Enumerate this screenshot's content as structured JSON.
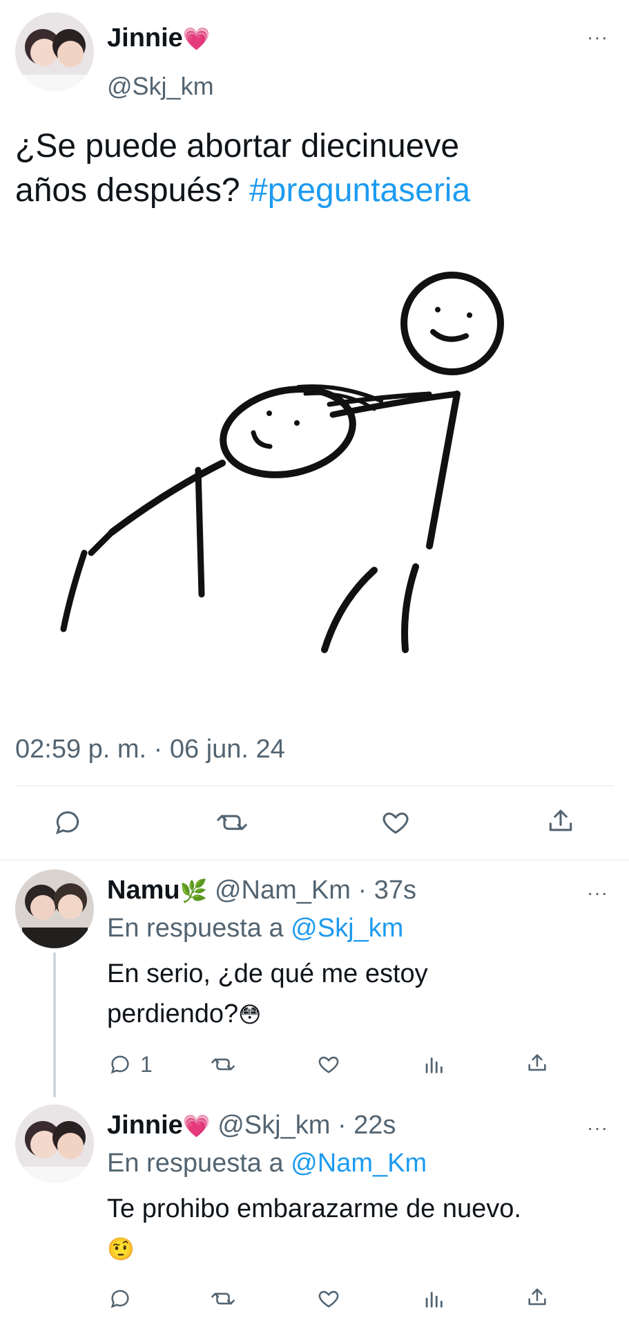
{
  "main_tweet": {
    "author_name": "Jinnie",
    "author_emoji": "💗",
    "author_handle": "@Skj_km",
    "text_part1": "¿Se puede abortar diecinueve",
    "text_part2": "años después? ",
    "hashtag": "#preguntaseria",
    "timestamp": "02:59 p. m. · 06 jun. 24",
    "more": "···",
    "action_icons": [
      "reply-icon",
      "retweet-icon",
      "like-icon",
      "share-icon"
    ]
  },
  "replies": [
    {
      "author_name": "Namu",
      "author_emoji": "🌿",
      "author_handle": "@Nam_Km",
      "time": "· 37s",
      "reply_prefix": "En respuesta a",
      "reply_to": "@Skj_km",
      "text_line1": "En serio, ¿de qué me estoy",
      "text_line2": "perdiendo?",
      "text_emoji": "😳",
      "reply_count": "1",
      "more": "···"
    },
    {
      "author_name": "Jinnie",
      "author_emoji": "💗",
      "author_handle": "@Skj_km",
      "time": "· 22s",
      "reply_prefix": "En respuesta a",
      "reply_to": "@Nam_Km",
      "text_line1": "Te prohibo embarazarme de nuevo.",
      "text_emoji": "🤨",
      "more": "···"
    }
  ],
  "colors": {
    "link": "#1d9bf0",
    "muted": "#536471",
    "text": "#0f1419"
  }
}
